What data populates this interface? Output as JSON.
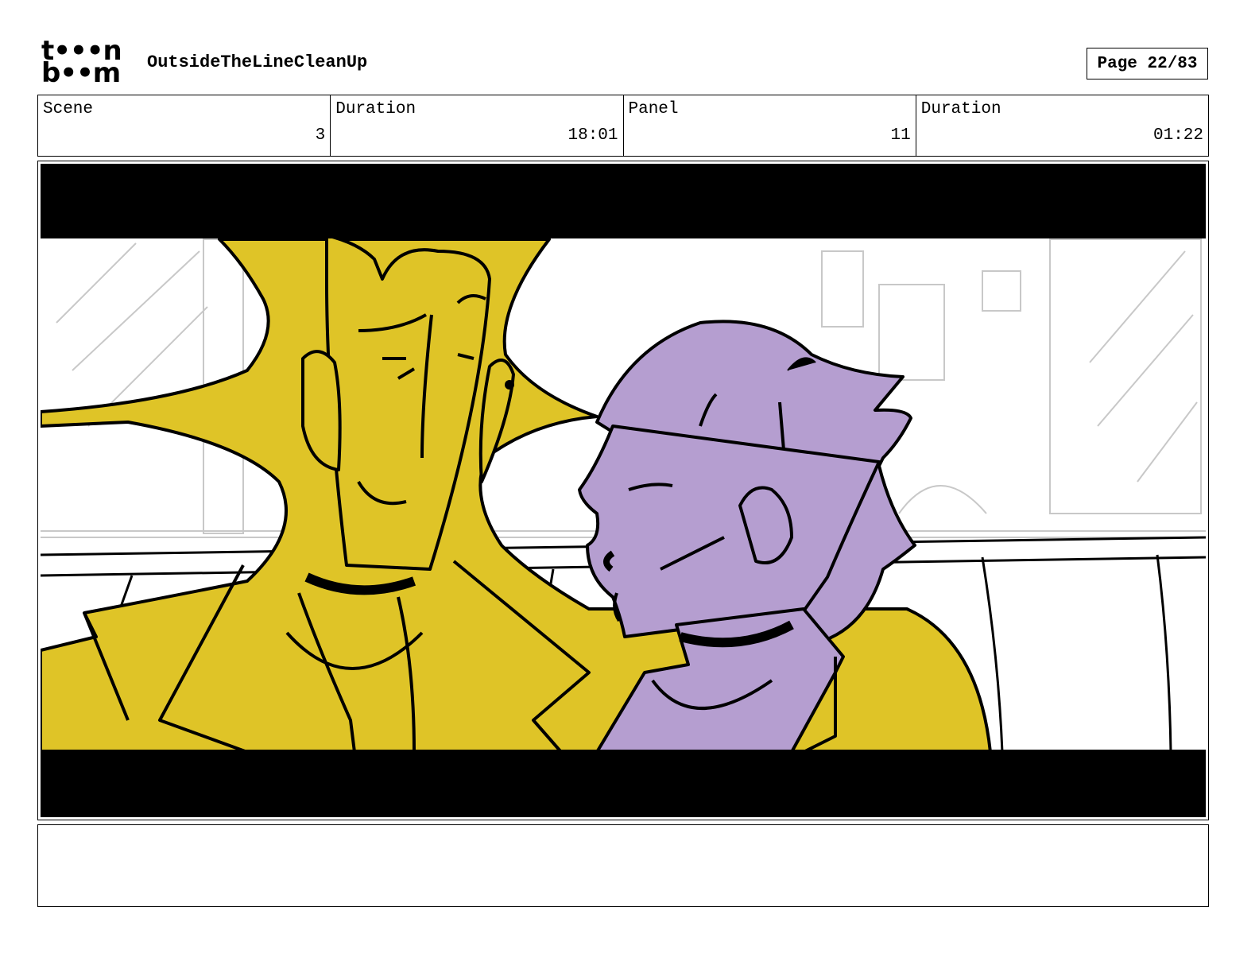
{
  "header": {
    "logo_line1": "t•••n",
    "logo_line2": "b••m",
    "project_title": "OutsideTheLineCleanUp",
    "page_label": "Page 22/83"
  },
  "info": {
    "scene_label": "Scene",
    "scene_value": "3",
    "scene_duration_label": "Duration",
    "scene_duration_value": "18:01",
    "panel_label": "Panel",
    "panel_value": "11",
    "panel_duration_label": "Duration",
    "panel_duration_value": "01:22"
  },
  "colors": {
    "letterbox": "#000000",
    "character_left": "#dfc427",
    "character_right": "#b59ed0",
    "sketch_lines": "#c8c8c8"
  },
  "notes": {
    "text": ""
  }
}
